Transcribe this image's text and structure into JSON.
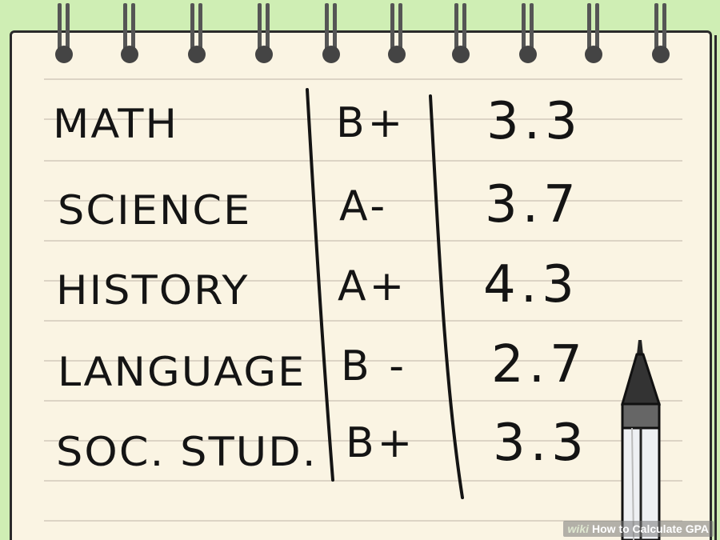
{
  "notebook": {
    "rows": [
      {
        "subject": "MATH",
        "grade": "B+",
        "points": "3.3"
      },
      {
        "subject": "SCIENCE",
        "grade": "A-",
        "points": "3.7"
      },
      {
        "subject": "HISTORY",
        "grade": "A+",
        "points": "4.3"
      },
      {
        "subject": "LANGUAGE",
        "grade": "B -",
        "points": "2.7"
      },
      {
        "subject": "SOC. STUD.",
        "grade": "B+",
        "points": "3.3"
      }
    ]
  },
  "watermark": {
    "brand": "wiki",
    "title": "How to Calculate GPA"
  },
  "colors": {
    "background": "#cfeeb4",
    "paper": "#faf4e3",
    "ink": "#141414",
    "rule_line": "#d9d2c4"
  }
}
